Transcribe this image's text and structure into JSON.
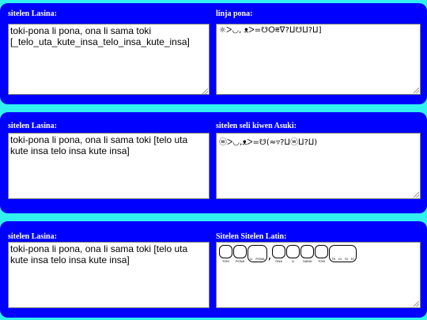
{
  "row1": {
    "left_label": "sitelen Lasina:",
    "left_text": "toki-pona li pona, ona li sama toki\n[_telo_uta_kute_insa_telo_insa_kute_insa]",
    "right_label": "linja pona:",
    "right_glyphs": "☼ᐳ◡, ᴥᐳ=☋ⵔ⩳ᐁ?ⵡ☋ⵡ?ⵡ]"
  },
  "row2": {
    "left_label": "sitelen Lasina:",
    "left_text": "toki-pona li pona, ona li sama toki [telo uta kute insa telo insa kute insa]",
    "right_label": "sitelen seli kiwen Asuki:",
    "right_glyphs": "ⓦᐳ◡,ᴥᐳ=☋(≈▿?ⵡⓦⵡ?ⵡ)"
  },
  "row3": {
    "left_label": "sitelen Lasina:",
    "left_text": "toki-pona li pona, ona li sama toki [telo uta kute insa telo insa kute insa]",
    "right_label": "Sitelen Sitelen Latin:",
    "captions": [
      "TOKI",
      "PONA",
      "LI",
      "PONA",
      "ONA",
      "LI",
      "SAMA",
      "TOKI",
      "TE",
      "KI",
      "SI",
      "KI"
    ]
  }
}
